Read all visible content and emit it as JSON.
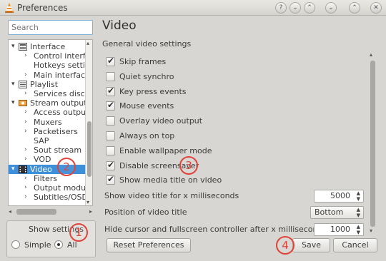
{
  "window": {
    "title": "Preferences"
  },
  "sidebar": {
    "search_placeholder": "Search",
    "tree": [
      {
        "label": "Interface",
        "arrow": "▾",
        "level": 0,
        "icon": "interface-icon"
      },
      {
        "label": "Control interfac",
        "arrow": "›",
        "level": 1
      },
      {
        "label": "Hotkeys setting",
        "arrow": "",
        "level": 1
      },
      {
        "label": "Main interfaces",
        "arrow": "›",
        "level": 1
      },
      {
        "label": "Playlist",
        "arrow": "▾",
        "level": 0,
        "icon": "playlist-icon"
      },
      {
        "label": "Services discove",
        "arrow": "›",
        "level": 1
      },
      {
        "label": "Stream output",
        "arrow": "▾",
        "level": 0,
        "icon": "stream-output-icon"
      },
      {
        "label": "Access output",
        "arrow": "›",
        "level": 1
      },
      {
        "label": "Muxers",
        "arrow": "›",
        "level": 1
      },
      {
        "label": "Packetisers",
        "arrow": "›",
        "level": 1
      },
      {
        "label": "SAP",
        "arrow": "",
        "level": 1
      },
      {
        "label": "Sout stream",
        "arrow": "›",
        "level": 1
      },
      {
        "label": "VOD",
        "arrow": "›",
        "level": 1
      },
      {
        "label": "Video",
        "arrow": "▾",
        "level": 0,
        "icon": "video-icon",
        "selected": true
      },
      {
        "label": "Filters",
        "arrow": "›",
        "level": 1
      },
      {
        "label": "Output module",
        "arrow": "›",
        "level": 1
      },
      {
        "label": "Subtitles/OSD",
        "arrow": "›",
        "level": 1
      }
    ],
    "show_settings_label": "Show settings",
    "radio_simple": "Simple",
    "radio_all": "All"
  },
  "main": {
    "title": "Video",
    "section_title": "General video settings",
    "checkboxes": [
      {
        "label": "Skip frames",
        "checked": true
      },
      {
        "label": "Quiet synchro",
        "checked": false
      },
      {
        "label": "Key press events",
        "checked": true
      },
      {
        "label": "Mouse events",
        "checked": true
      },
      {
        "label": "Overlay video output",
        "checked": false
      },
      {
        "label": "Always on top",
        "checked": false
      },
      {
        "label": "Enable wallpaper mode",
        "checked": false
      },
      {
        "label": "Disable screensaver",
        "checked": true
      },
      {
        "label": "Show media title on video",
        "checked": true
      }
    ],
    "fields": {
      "title_ms_label": "Show video title for x milliseconds",
      "title_ms_value": "5000",
      "position_label": "Position of video title",
      "position_value": "Bottom",
      "hide_cursor_label": "Hide cursor and fullscreen controller after x milliseconds",
      "hide_cursor_value": "1000"
    }
  },
  "buttons": {
    "reset": "Reset Preferences",
    "save": "Save",
    "cancel": "Cancel"
  },
  "annotations": [
    "1",
    "2",
    "3",
    "4"
  ],
  "colors": {
    "selection": "#3d8fd9",
    "annotation": "#e0433a"
  }
}
